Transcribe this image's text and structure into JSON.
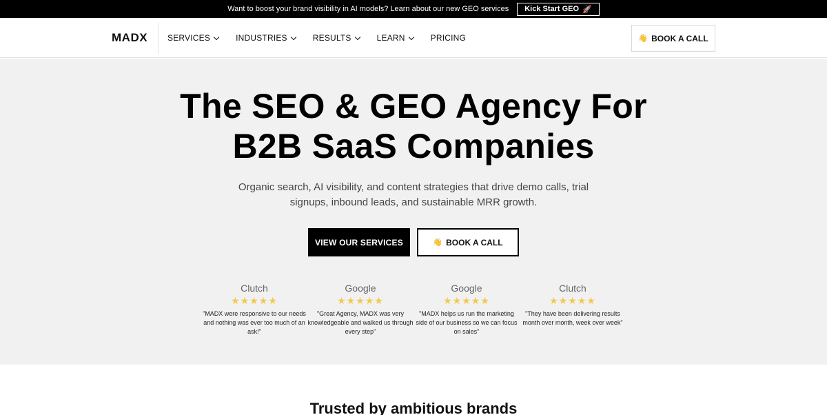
{
  "announcement": {
    "text": "Want to boost your brand visibility in AI models? Learn about our new GEO services",
    "button_label": "Kick Start GEO",
    "button_icon": "rocket-icon"
  },
  "nav": {
    "logo": "MADX",
    "items": [
      {
        "label": "SERVICES",
        "has_dropdown": true
      },
      {
        "label": "INDUSTRIES",
        "has_dropdown": true
      },
      {
        "label": "RESULTS",
        "has_dropdown": true
      },
      {
        "label": "LEARN",
        "has_dropdown": true
      },
      {
        "label": "PRICING",
        "has_dropdown": false
      }
    ],
    "cta_label": "BOOK A CALL",
    "cta_icon": "hand-wave-icon"
  },
  "hero": {
    "headline_line1": "The SEO & GEO Agency For",
    "headline_line2": "B2B SaaS Companies",
    "subtext": "Organic search, AI visibility, and content strategies that drive demo calls, trial signups, inbound leads, and sustainable MRR growth.",
    "primary_button": "VIEW OUR SERVICES",
    "secondary_button": "BOOK A CALL"
  },
  "reviews": [
    {
      "source": "Clutch",
      "stars": "★★★★★",
      "quote": "\"MADX were responsive to our needs and nothing was ever too much of an ask!\""
    },
    {
      "source": "Google",
      "stars": "★★★★★",
      "quote": "\"Great Agency, MADX was very knowledgeable and walked us through every step\""
    },
    {
      "source": "Google",
      "stars": "★★★★★",
      "quote": "\"MADX helps us run the marketing side of our business so we can focus on sales\""
    },
    {
      "source": "Clutch",
      "stars": "★★★★★",
      "quote": "\"They have been delivering results month over month, week over week\""
    }
  ],
  "trusted": {
    "heading": "Trusted by ambitious brands"
  },
  "colors": {
    "accent_star": "#f2c94c",
    "hero_bg": "#f1f1f1",
    "primary": "#000000"
  }
}
